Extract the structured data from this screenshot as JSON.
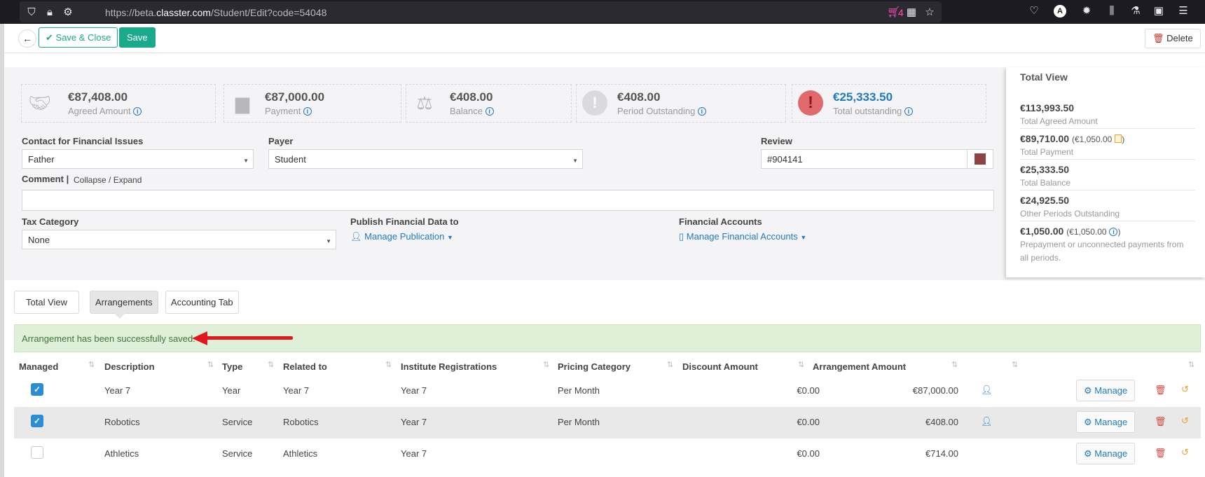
{
  "browser": {
    "url_prefix": "https://beta.",
    "url_domain": "classter.com",
    "url_path": "/Student/Edit?code=54048",
    "cart_count": "4"
  },
  "toolbar": {
    "back_icon": "arrow-left-icon",
    "save_close_label": "Save & Close",
    "save_label": "Save",
    "delete_label": "Delete"
  },
  "stats": [
    {
      "value": "€87,408.00",
      "label": "Agreed Amount",
      "icon": "handshake-icon"
    },
    {
      "value": "€87,000.00",
      "label": "Payment",
      "icon": "bar-chart-icon"
    },
    {
      "value": "€408.00",
      "label": "Balance",
      "icon": "scales-icon"
    },
    {
      "value": "€408.00",
      "label": "Period Outstanding",
      "icon": "exclamation-circle-icon"
    },
    {
      "value": "€25,333.50",
      "label": "Total outstanding",
      "icon": "alert-circle-icon"
    }
  ],
  "form": {
    "contact_label": "Contact for Financial Issues",
    "contact_value": "Father",
    "payer_label": "Payer",
    "payer_value": "Student",
    "review_label": "Review",
    "review_value": "#904141",
    "review_color": "#904141",
    "comment_label": "Comment",
    "collapse_label": "Collapse / Expand",
    "tax_label": "Tax Category",
    "tax_value": "None",
    "publish_label": "Publish Financial Data to",
    "publish_link": "Manage Publication",
    "accounts_label": "Financial Accounts",
    "accounts_link": "Manage Financial Accounts"
  },
  "total_view": {
    "title": "Total View",
    "items": [
      {
        "value": "€113,993.50",
        "extra": "",
        "label": "Total Agreed Amount"
      },
      {
        "value": "€89,710.00",
        "extra": "(€1,050.00",
        "label": "Total Payment"
      },
      {
        "value": "€25,333.50",
        "extra": "",
        "label": "Total Balance"
      },
      {
        "value": "€24,925.50",
        "extra": "",
        "label": "Other Periods Outstanding"
      },
      {
        "value": "€1,050.00",
        "extra": "(€1,050.00",
        "label": "Prepayment or unconnected payments from all periods."
      }
    ]
  },
  "tabs": [
    "Total View",
    "Arrangements",
    "Accounting Tab"
  ],
  "alert": "Arrangement has been successfully saved.",
  "table": {
    "headers": [
      "Managed",
      "Description",
      "Type",
      "Related to",
      "Institute Registrations",
      "Pricing Category",
      "Discount Amount",
      "Arrangement Amount"
    ],
    "manage_label": "Manage",
    "rows": [
      {
        "managed": true,
        "description": "Year 7",
        "type": "Year",
        "related": "Year 7",
        "registration": "Year 7",
        "pricing": "Per Month",
        "discount": "€0.00",
        "amount": "€87,000.00"
      },
      {
        "managed": true,
        "description": "Robotics",
        "type": "Service",
        "related": "Robotics",
        "registration": "Year 7",
        "pricing": "Per Month",
        "discount": "€0.00",
        "amount": "€408.00"
      },
      {
        "managed": false,
        "description": "Athletics",
        "type": "Service",
        "related": "Athletics",
        "registration": "Year 7",
        "pricing": "",
        "discount": "€0.00",
        "amount": "€714.00"
      }
    ]
  },
  "colors": {
    "accent": "#1aa98a",
    "link": "#1f7bbf",
    "alert_bg": "#dff0d8",
    "danger": "#d24a3c"
  }
}
